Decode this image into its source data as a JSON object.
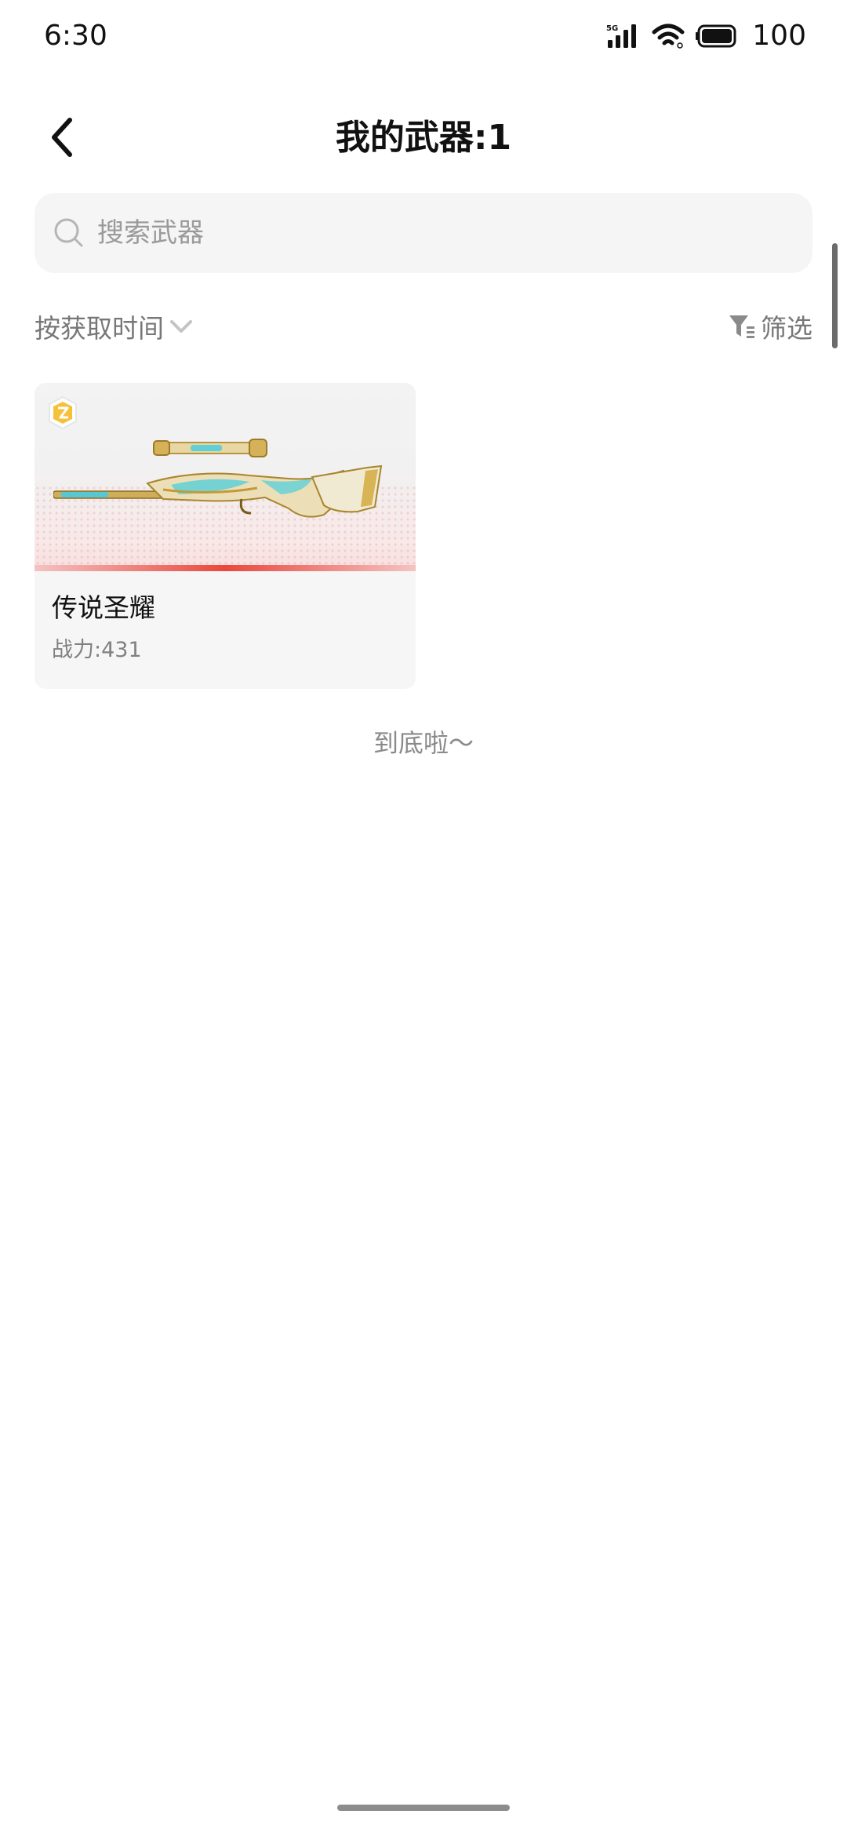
{
  "status_bar": {
    "time": "6:30",
    "network": "5G",
    "battery": "100"
  },
  "header": {
    "title": "我的武器:1",
    "back_icon": "chevron-left-icon"
  },
  "search": {
    "placeholder": "搜索武器",
    "value": "",
    "icon": "search-icon"
  },
  "toolbar": {
    "sort_label": "按获取时间",
    "sort_icon": "chevron-down-icon",
    "filter_label": "筛选",
    "filter_icon": "funnel-icon"
  },
  "weapons": [
    {
      "name": "传说圣耀",
      "power": "战力:431",
      "rarity_color": "#e9483c"
    }
  ],
  "list_end_text": "到底啦～"
}
